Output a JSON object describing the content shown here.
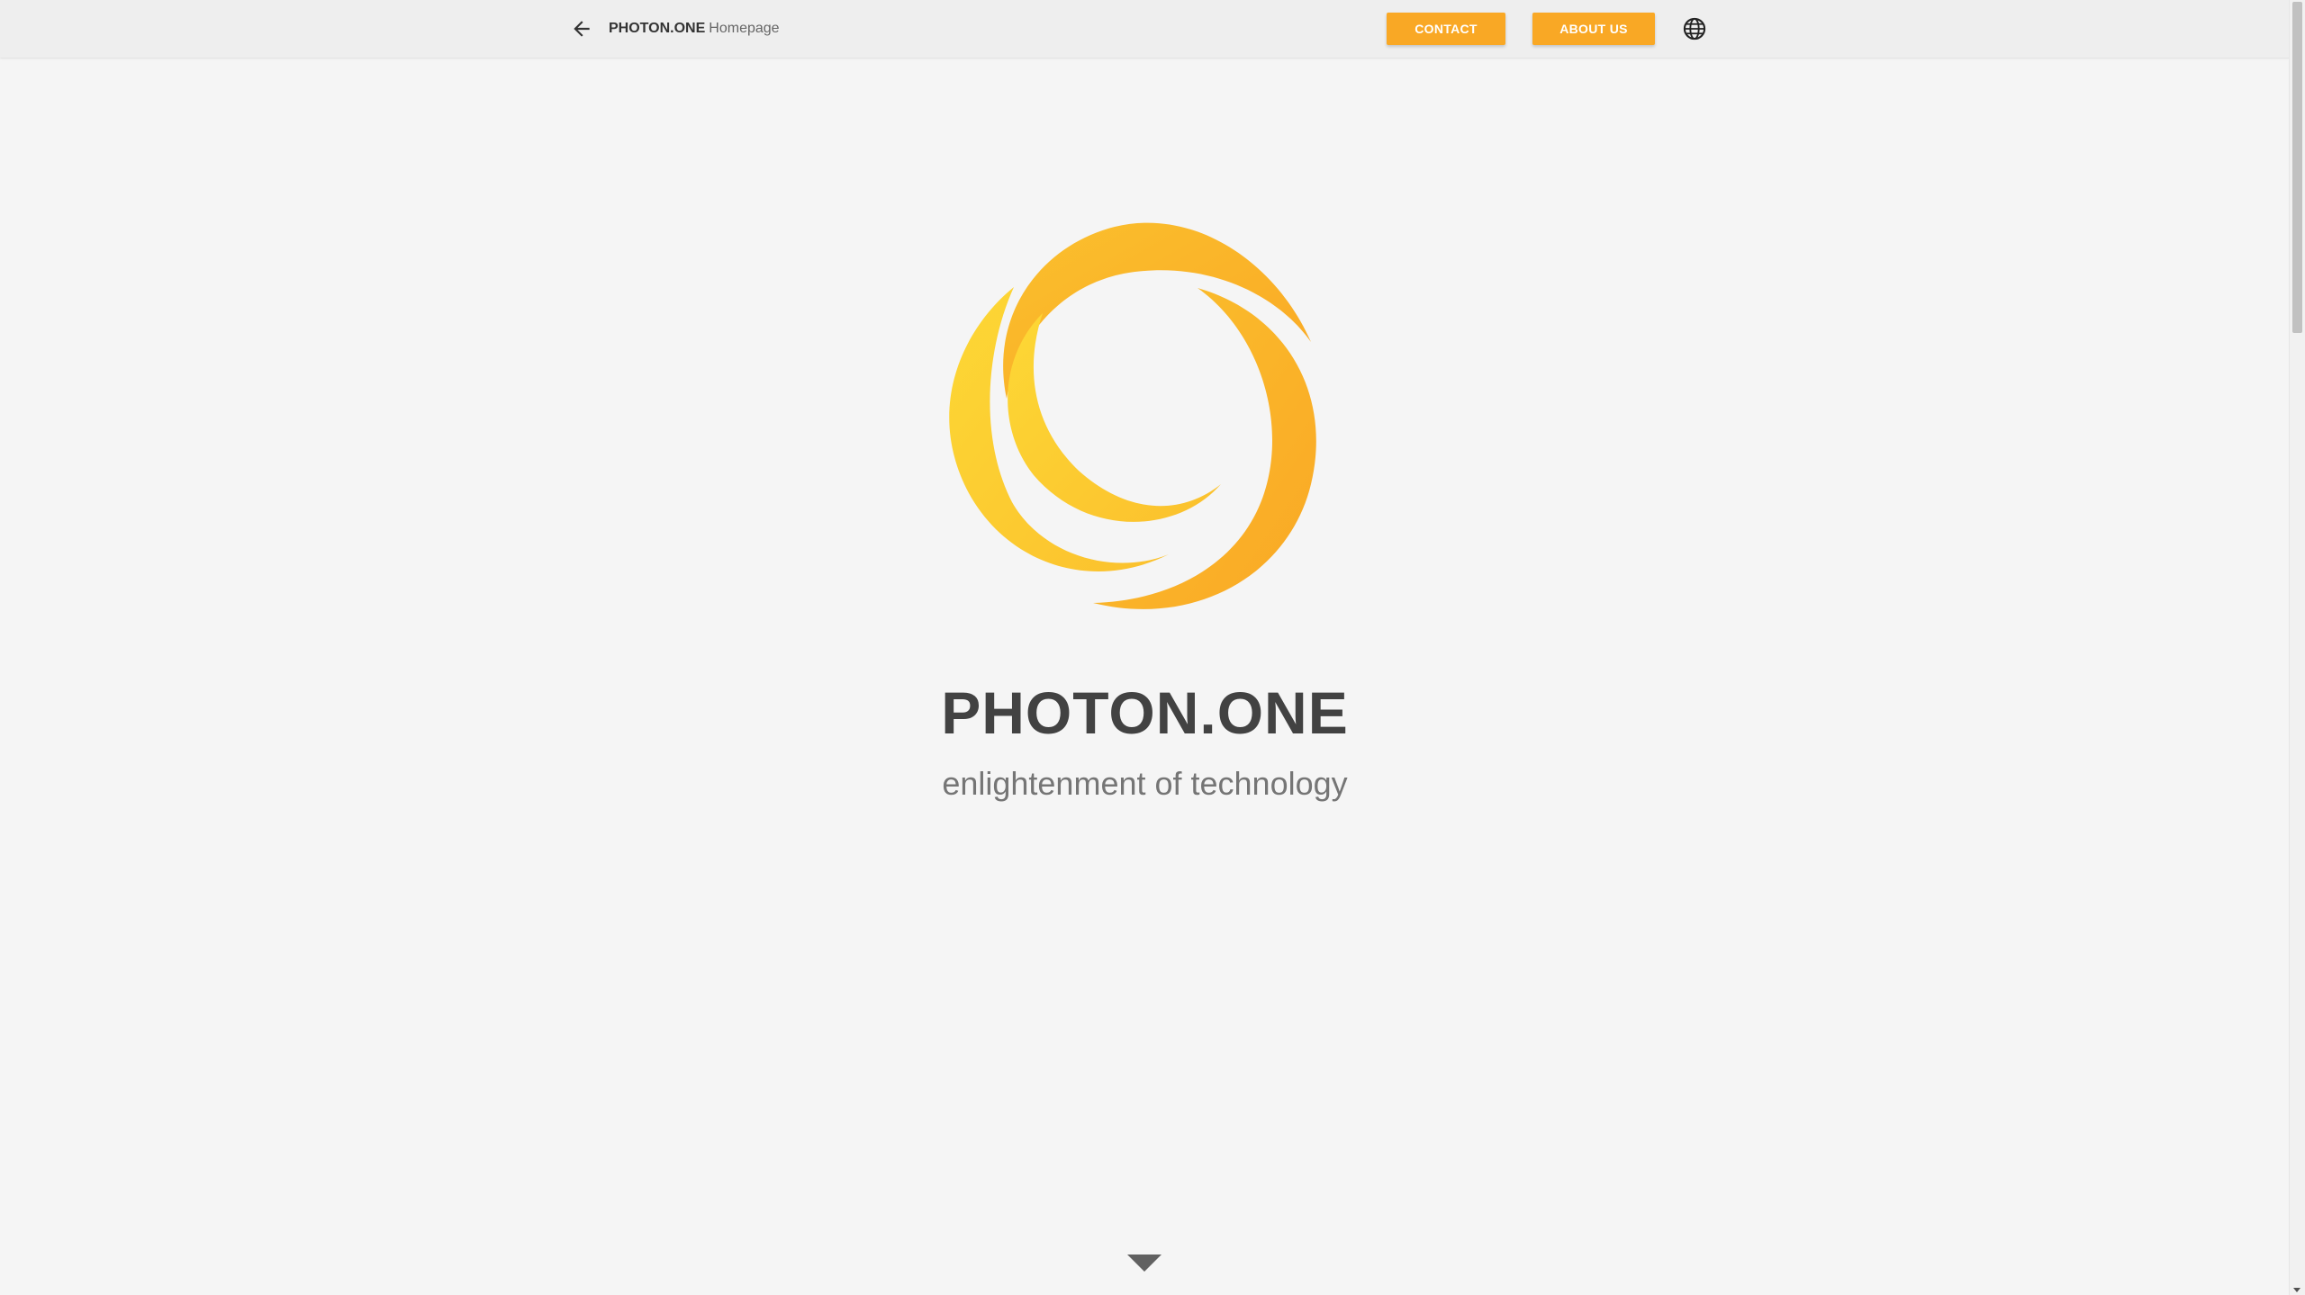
{
  "header": {
    "brand_name": "PHOTON.ONE",
    "brand_sub": "Homepage",
    "back_icon": "arrow-left-icon",
    "language_icon": "globe-icon",
    "nav": {
      "contact_label": "CONTACT",
      "about_label": "ABOUT US"
    }
  },
  "hero": {
    "logo_icon": "photon-swirl-logo",
    "title": "PHOTON.ONE",
    "subtitle": "enlightenment of technology",
    "scroll_icon": "caret-down-icon"
  },
  "colors": {
    "accent": "#f9a825",
    "logo_light": "#fdd835",
    "logo_dark": "#f9a825",
    "background": "#f5f5f5",
    "title": "#424242",
    "subtitle": "#757575"
  }
}
